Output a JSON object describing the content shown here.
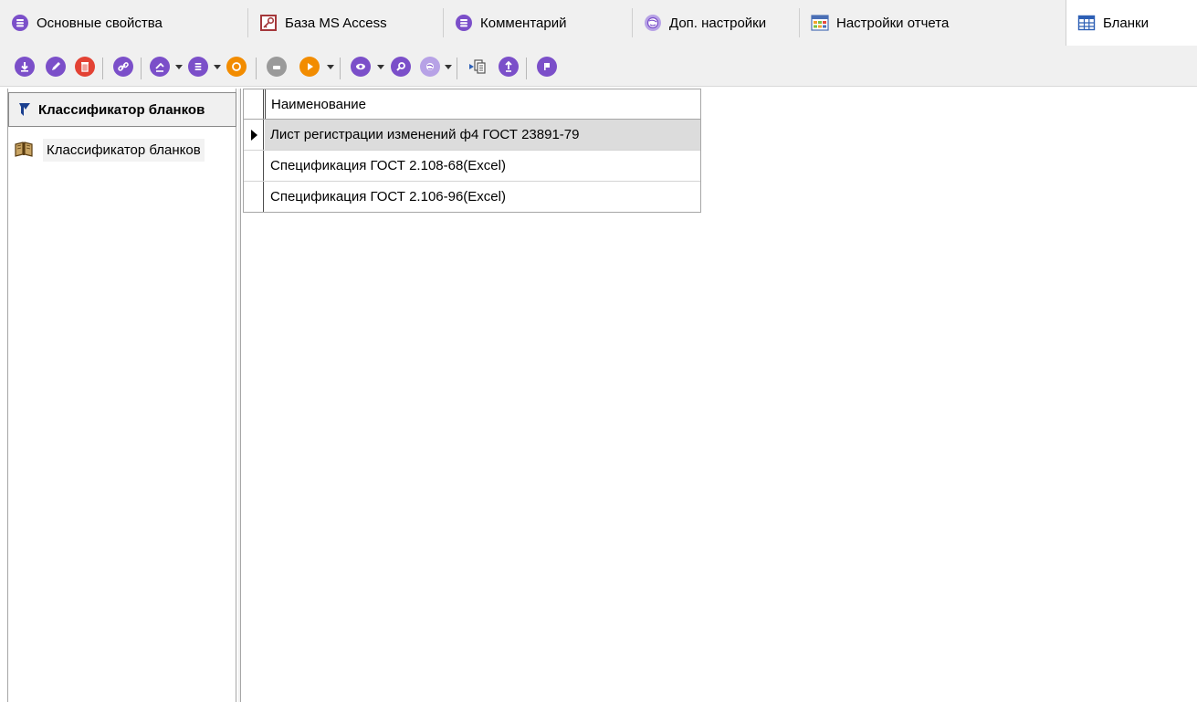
{
  "tabs": [
    {
      "label": "Основные свойства",
      "icon": "database-icon"
    },
    {
      "label": "База MS Access",
      "icon": "key-icon"
    },
    {
      "label": "Комментарий",
      "icon": "database-icon"
    },
    {
      "label": "Доп. настройки",
      "icon": "globe-icon"
    },
    {
      "label": "Настройки отчета",
      "icon": "report-icon"
    },
    {
      "label": "Бланки",
      "icon": "table-icon",
      "active": true
    }
  ],
  "toolbar": {
    "buttons": [
      "add-icon",
      "edit-icon",
      "delete-icon",
      "link-icon",
      "database-icon",
      "refresh-icon",
      "print-icon",
      "run-icon",
      "view-icon",
      "search-icon",
      "globe-icon",
      "copy-icon",
      "upload-icon",
      "flag-icon"
    ]
  },
  "left_panel": {
    "title": "Классификатор бланков",
    "tree_items": [
      {
        "label": "Классификатор бланков",
        "icon": "book-icon"
      }
    ]
  },
  "grid": {
    "columns": [
      "Наименование"
    ],
    "rows": [
      {
        "name": "Лист регистрации изменений ф4 ГОСТ 23891-79",
        "selected": true
      },
      {
        "name": "Спецификация ГОСТ 2.108-68(Excel)",
        "selected": false
      },
      {
        "name": "Спецификация ГОСТ 2.106-96(Excel)",
        "selected": false
      }
    ]
  },
  "colors": {
    "accent_purple": "#7b4fc9",
    "delete_red": "#e34234",
    "run_orange": "#f28c00",
    "print_gray": "#9a9a9a",
    "access_red": "#a4373a"
  }
}
